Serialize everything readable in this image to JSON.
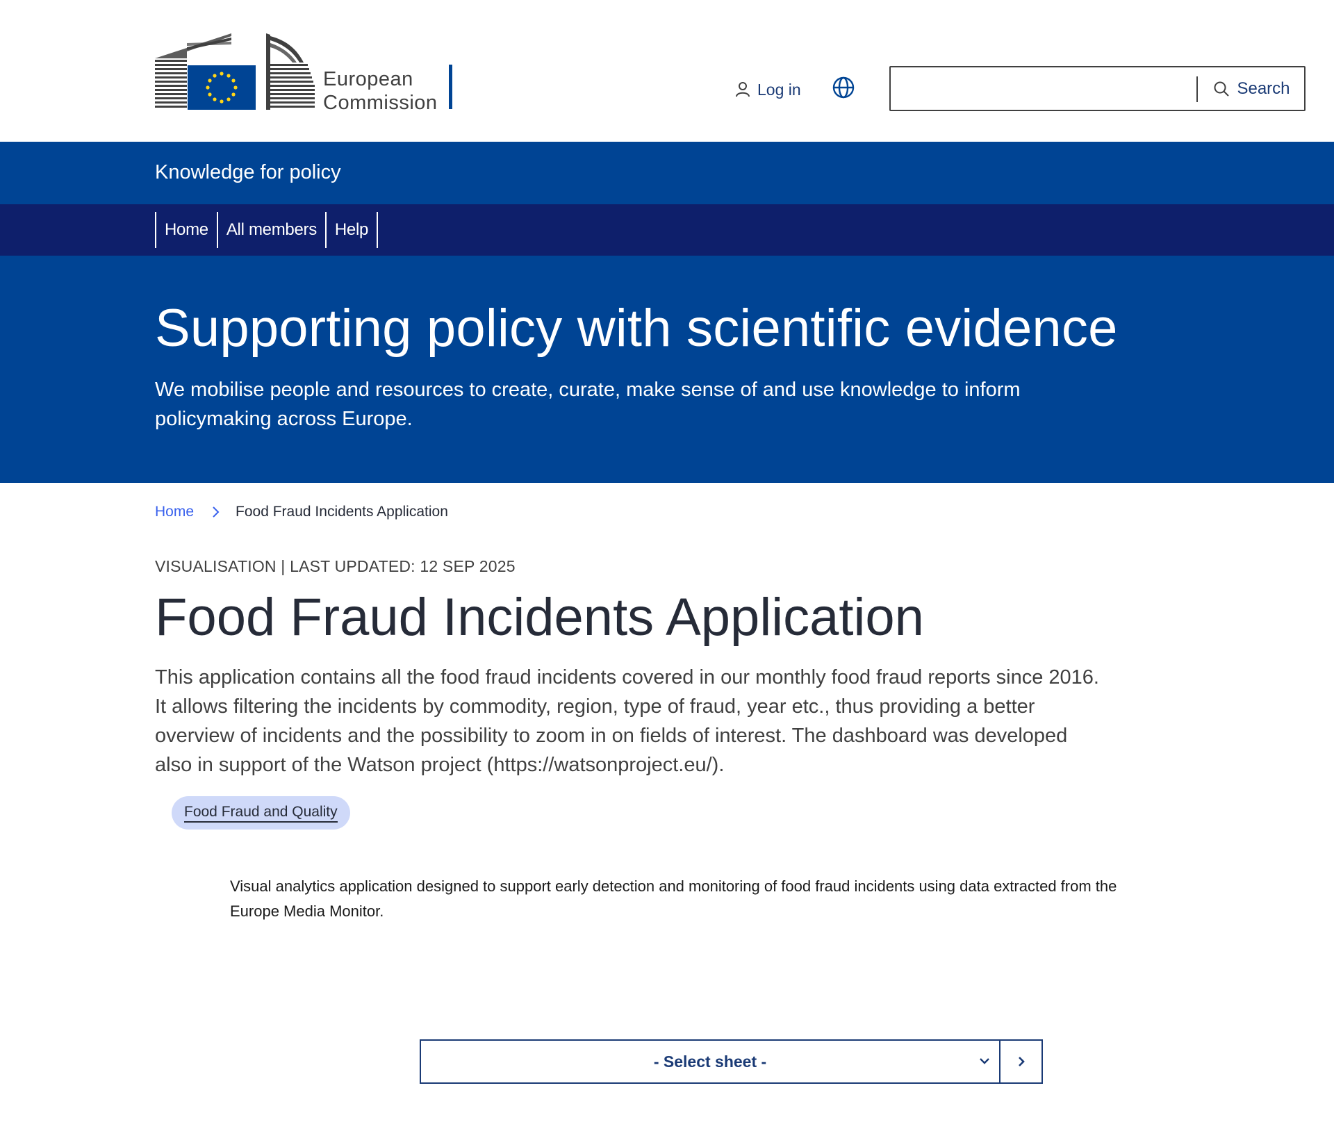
{
  "header": {
    "logo_line1": "European",
    "logo_line2": "Commission",
    "login_label": "Log in",
    "login_icon": "user-icon",
    "language_icon": "globe-icon",
    "search": {
      "placeholder": "",
      "button_label": "Search",
      "icon": "search-icon"
    }
  },
  "site_name": "Knowledge for policy",
  "menu": {
    "items": [
      {
        "label": "Home"
      },
      {
        "label": "All members"
      },
      {
        "label": "Help"
      }
    ]
  },
  "hero": {
    "title": "Supporting policy with scientific evidence",
    "text": "We mobilise people and resources to create, curate, make sense of and use knowledge to inform policymaking across Europe."
  },
  "breadcrumb": {
    "home": "Home",
    "separator_icon": "chevron-right-icon",
    "current": "Food Fraud Incidents Application"
  },
  "page": {
    "meta": "VISUALISATION | LAST UPDATED: 12 SEP 2025",
    "title": "Food Fraud Incidents Application",
    "description": "This application contains all the food fraud incidents covered in our monthly food fraud reports since 2016. It allows filtering the incidents by commodity, region, type of fraud, year etc., thus providing a better overview of incidents and the possibility to zoom in on fields of interest. The dashboard was developed also in support of the Watson project (https://watsonproject.eu/).",
    "tag": "Food Fraud and Quality"
  },
  "app": {
    "description": "Visual analytics application designed to support early detection and monitoring of food fraud incidents using data extracted from the Europe Media Monitor.",
    "sheet_select": {
      "value": "- Select sheet -",
      "dropdown_icon": "chevron-down-icon",
      "go_icon": "chevron-right-icon"
    }
  },
  "colors": {
    "primary": "#004494",
    "menu": "#0e1f6b",
    "link": "#3860ed",
    "tag_bg": "#cfd9f9",
    "eu_yellow": "#ffd617"
  }
}
